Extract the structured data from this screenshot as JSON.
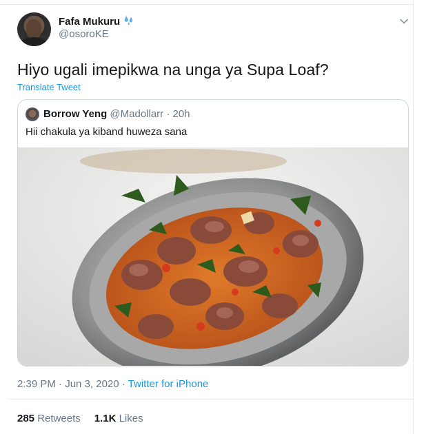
{
  "author": {
    "display_name": "Fafa Mukuru",
    "handle": "@osoroKE",
    "badge_icon": "raindrops-emoji"
  },
  "tweet": {
    "text": "Hiyo ugali imepikwa na unga ya Supa Loaf?",
    "translate_label": "Translate Tweet"
  },
  "quoted_tweet": {
    "display_name": "Borrow Yeng",
    "meta": "@Madollarr · 20h",
    "text": "Hii chakula ya kiband huweza sana",
    "image_description": "plate of meat and greens"
  },
  "footer": {
    "timestamp": "2:39 PM · Jun 3, 2020 · ",
    "source": "Twitter for iPhone",
    "retweets_count": "285",
    "retweets_label": "Retweets",
    "likes_count": "1.1K",
    "likes_label": "Likes"
  },
  "colors": {
    "link": "#1b95e0",
    "secondary_text": "#657786",
    "primary_text": "#14171a",
    "border": "#e6ecf0"
  }
}
